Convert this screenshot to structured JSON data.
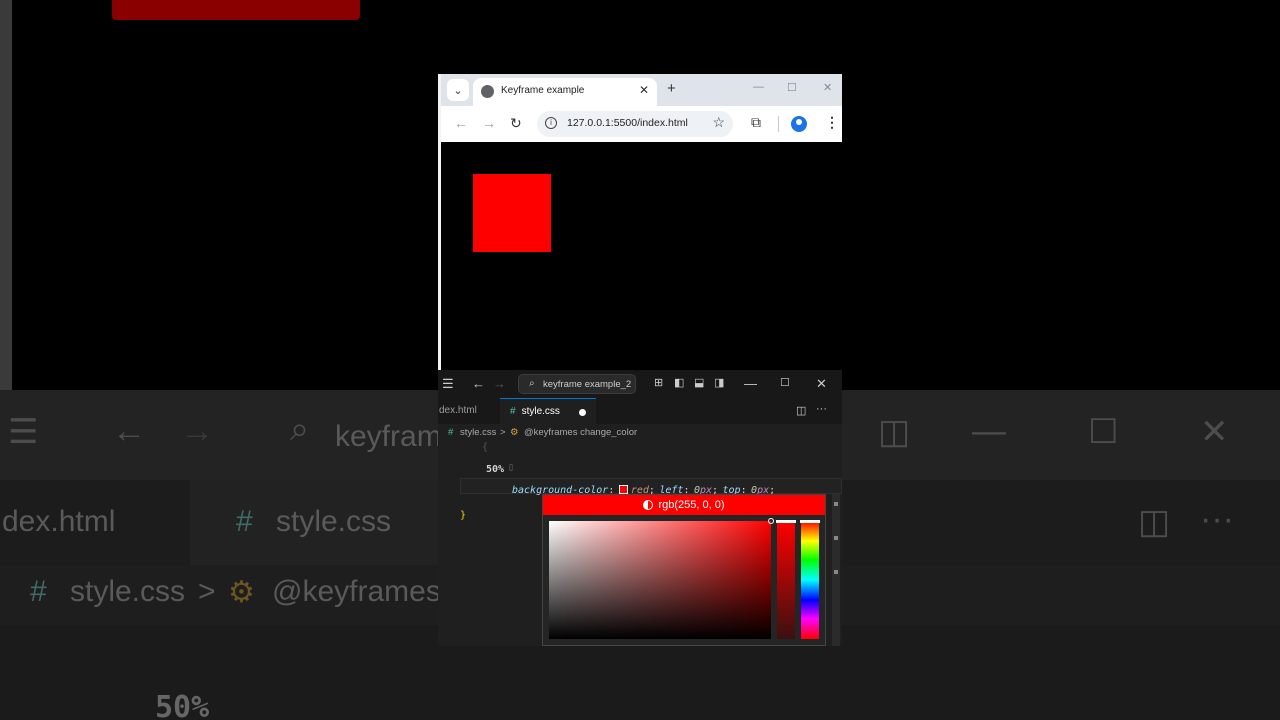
{
  "background": {
    "search_text": "keyfram",
    "tab_inactive": "dex.html",
    "tab_active": "style.css",
    "crumb_file": "style.css",
    "crumb_symbol": "@keyframes",
    "code_text": "50%"
  },
  "browser": {
    "tab_title": "Keyframe example",
    "url": "127.0.0.1:5500/index.html",
    "box_color": "#ff0000"
  },
  "vscode": {
    "search_text": "keyframe example_2",
    "tabs": [
      {
        "label": "dex.html"
      },
      {
        "label": "style.css"
      }
    ],
    "breadcrumb": {
      "file": "style.css",
      "symbol": "@keyframes change_color"
    },
    "code": {
      "brace_open": "{",
      "selector": "50%",
      "property": "background-color",
      "colon": ":",
      "value": "red",
      "semicolon": ";",
      "left_prop": "left",
      "left_num": "0",
      "left_unit": "px",
      "top_prop": "top",
      "top_num": "0",
      "top_unit": "px",
      "brace_close": "}"
    },
    "picker": {
      "value": "rgb(255, 0, 0)",
      "color": "#ff0000"
    }
  },
  "colors": {
    "accent": "#0078d4",
    "property": "#9cdcfe",
    "number": "#b5cea8",
    "unit": "#c586c0",
    "brace": "#ffd700"
  }
}
